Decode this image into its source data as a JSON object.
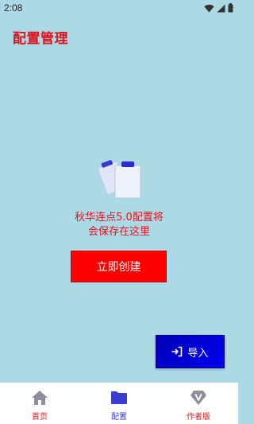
{
  "status": {
    "time": "2:08"
  },
  "header": {
    "title": "配置管理"
  },
  "empty_state": {
    "line1": "秋华连点5.0配置将",
    "line2": "会保存在这里"
  },
  "actions": {
    "create_label": "立即创建",
    "import_label": "导入"
  },
  "bottom_nav": {
    "items": [
      {
        "label": "首页",
        "icon": "home-icon",
        "active": false
      },
      {
        "label": "配置",
        "icon": "folder-icon",
        "active": true
      },
      {
        "label": "作者版",
        "icon": "v-badge-icon",
        "active": false
      }
    ]
  },
  "colors": {
    "background": "#add8e6",
    "accent_red": "#e0141e",
    "button_red": "#ff0000",
    "button_blue": "#0000e0",
    "nav_active": "#3b3bd6"
  }
}
